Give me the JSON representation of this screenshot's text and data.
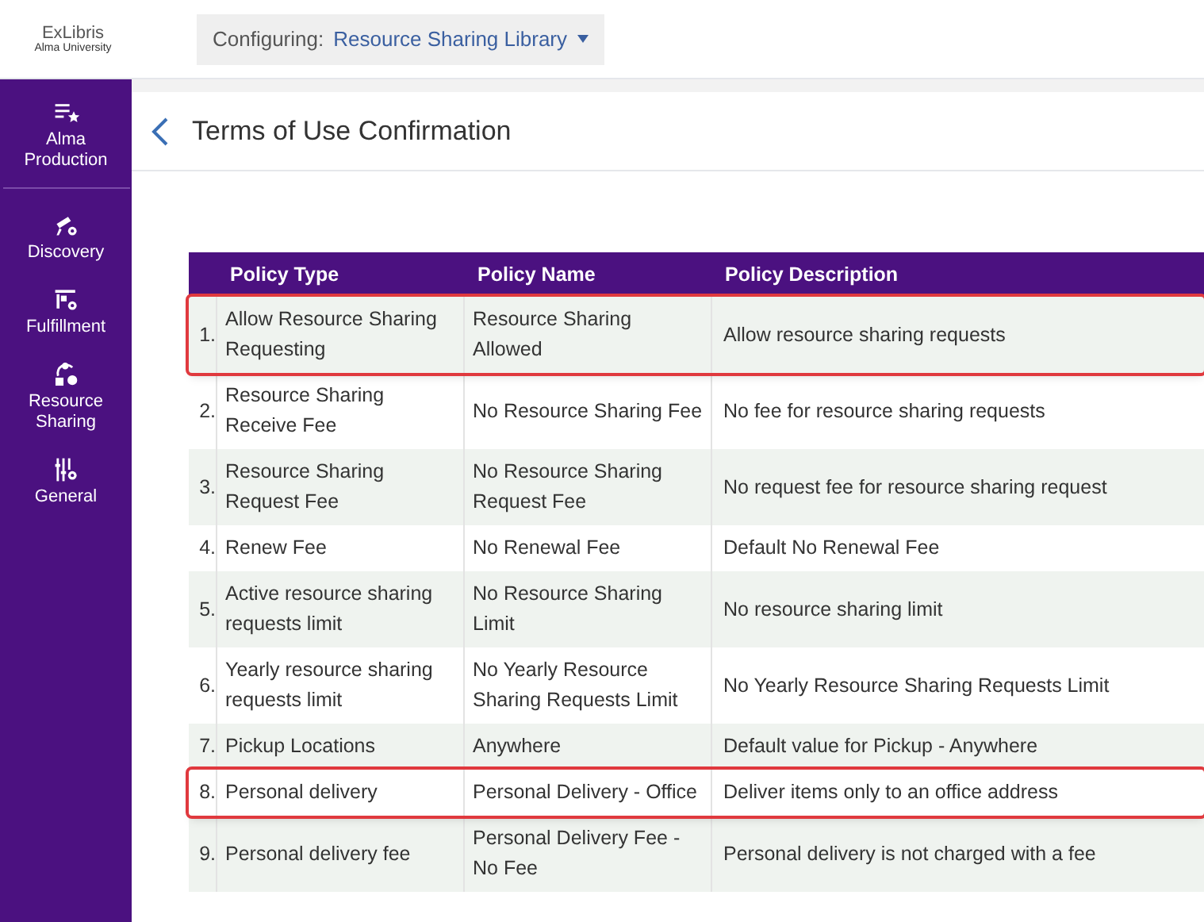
{
  "header": {
    "logo_text": "ExLibris",
    "logo_subtext": "Alma University",
    "configuring_label": "Configuring:",
    "configuring_value": "Resource Sharing Library"
  },
  "sidebar": {
    "items": [
      {
        "label": "Alma Production",
        "kind": "production"
      },
      {
        "label": "Discovery",
        "kind": "discovery"
      },
      {
        "label": "Fulfillment",
        "kind": "fulfillment"
      },
      {
        "label": "Resource Sharing",
        "kind": "sharing"
      },
      {
        "label": "General",
        "kind": "general"
      }
    ]
  },
  "page": {
    "title": "Terms of Use Confirmation"
  },
  "table": {
    "columns": [
      "Policy Type",
      "Policy Name",
      "Policy Description"
    ],
    "rows": [
      {
        "number": "1.",
        "type": "Allow Resource Sharing Requesting",
        "name": "Resource Sharing Allowed",
        "description": "Allow resource sharing requests",
        "highlighted": true
      },
      {
        "number": "2.",
        "type": "Resource Sharing Receive Fee",
        "name": "No Resource Sharing Fee",
        "description": "No fee for resource sharing requests",
        "highlighted": false
      },
      {
        "number": "3.",
        "type": "Resource Sharing Request Fee",
        "name": "No Resource Sharing Request Fee",
        "description": "No request fee for resource sharing request",
        "highlighted": false
      },
      {
        "number": "4.",
        "type": "Renew Fee",
        "name": "No Renewal Fee",
        "description": "Default No Renewal Fee",
        "highlighted": false
      },
      {
        "number": "5.",
        "type": "Active resource sharing requests limit",
        "name": "No Resource Sharing Limit",
        "description": "No resource sharing limit",
        "highlighted": false
      },
      {
        "number": "6.",
        "type": "Yearly resource sharing requests limit",
        "name": "No Yearly Resource Sharing Requests Limit",
        "description": "No Yearly Resource Sharing Requests Limit",
        "highlighted": false
      },
      {
        "number": "7.",
        "type": "Pickup Locations",
        "name": "Anywhere",
        "description": "Default value for Pickup - Anywhere",
        "highlighted": false
      },
      {
        "number": "8.",
        "type": "Personal delivery",
        "name": "Personal Delivery - Office",
        "description": "Deliver items only to an office address",
        "highlighted": true
      },
      {
        "number": "9.",
        "type": "Personal delivery fee",
        "name": "Personal Delivery Fee - No Fee",
        "description": "Personal delivery is not charged with a fee",
        "highlighted": false
      }
    ]
  }
}
